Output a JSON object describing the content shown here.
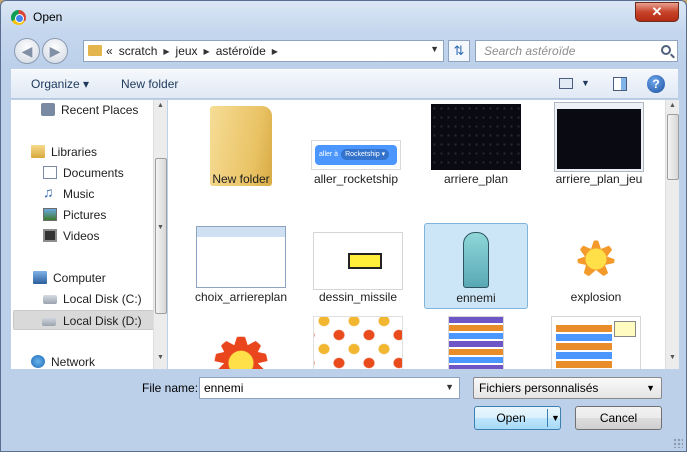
{
  "window": {
    "title": "Open",
    "close_label": "✕"
  },
  "address": {
    "prefix": "«",
    "crumbs": [
      "scratch",
      "jeux",
      "astéroïde"
    ]
  },
  "search": {
    "placeholder": "Search astéroïde"
  },
  "toolbar": {
    "organize_label": "Organize ▾",
    "new_folder_label": "New folder",
    "help_label": "?"
  },
  "nav": {
    "recent_places": "Recent Places",
    "libraries": "Libraries",
    "documents": "Documents",
    "music": "Music",
    "pictures": "Pictures",
    "videos": "Videos",
    "computer": "Computer",
    "disk_c": "Local Disk (C:)",
    "disk_d": "Local Disk (D:)",
    "network": "Network"
  },
  "files": [
    {
      "label": "New folder",
      "kind": "folder"
    },
    {
      "label": "aller_rocketship",
      "kind": "image",
      "block_text": "aller à",
      "block_chip": "Rocketship ▾"
    },
    {
      "label": "arriere_plan",
      "kind": "image"
    },
    {
      "label": "arriere_plan_jeu",
      "kind": "image"
    },
    {
      "label": "choix_arriereplan",
      "kind": "image"
    },
    {
      "label": "dessin_missile",
      "kind": "image"
    },
    {
      "label": "ennemi",
      "kind": "image",
      "selected": true
    },
    {
      "label": "explosion",
      "kind": "image"
    },
    {
      "label": "",
      "kind": "image"
    },
    {
      "label": "",
      "kind": "image"
    },
    {
      "label": "",
      "kind": "image"
    },
    {
      "label": "",
      "kind": "image"
    }
  ],
  "bottom": {
    "file_name_label": "File name:",
    "file_name_value": "ennemi",
    "file_type_value": "Fichiers personnalisés",
    "open_label": "Open",
    "cancel_label": "Cancel"
  },
  "colors": {
    "selection": "#cde6f7",
    "open_button_border": "#3c7fb1",
    "close_button": "#c7432a"
  }
}
